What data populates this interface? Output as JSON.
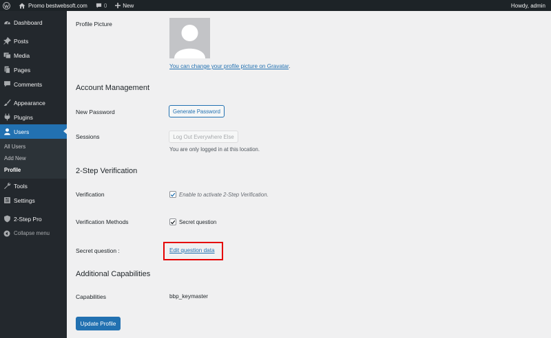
{
  "admin_bar": {
    "site_name": "Promo bestwebsoft.com",
    "comments_count": "0",
    "new_label": "New",
    "howdy": "Howdy, admin"
  },
  "sidebar": {
    "items": [
      {
        "label": "Dashboard",
        "icon": "dashboard-icon"
      },
      {
        "label": "Posts",
        "icon": "pin-icon"
      },
      {
        "label": "Media",
        "icon": "media-icon"
      },
      {
        "label": "Pages",
        "icon": "pages-icon"
      },
      {
        "label": "Comments",
        "icon": "comments-icon"
      },
      {
        "label": "Appearance",
        "icon": "paintbrush-icon"
      },
      {
        "label": "Plugins",
        "icon": "plugin-icon"
      },
      {
        "label": "Users",
        "icon": "user-icon"
      },
      {
        "label": "Tools",
        "icon": "wrench-icon"
      },
      {
        "label": "Settings",
        "icon": "settings-icon"
      },
      {
        "label": "2-Step Pro",
        "icon": "shield-icon"
      }
    ],
    "users_submenu": [
      "All Users",
      "Add New",
      "Profile"
    ],
    "collapse_label": "Collapse menu"
  },
  "profile": {
    "picture_label": "Profile Picture",
    "gravatar_link": "You can change your profile picture on Gravatar",
    "gravatar_suffix": ".",
    "account_title": "Account Management",
    "new_password_label": "New Password",
    "generate_password_button": "Generate Password",
    "sessions_label": "Sessions",
    "logout_everywhere_button": "Log Out Everywhere Else",
    "sessions_note": "You are only logged in at this location.",
    "two_step_title": "2-Step Verification",
    "verification_label": "Verification",
    "verification_checkbox_label": "Enable to activate 2-Step Verification.",
    "verification_checked": true,
    "methods_label": "Verification Methods",
    "secret_question_checkbox_label": "Secret question",
    "secret_question_checked": true,
    "secret_question_label": "Secret question :",
    "edit_question_link": "Edit question data",
    "capabilities_title": "Additional Capabilities",
    "capabilities_label": "Capabilities",
    "capabilities_value": "bbp_keymaster",
    "update_button": "Update Profile"
  },
  "colors": {
    "accent": "#2271b1",
    "admin_bar": "#1d2327",
    "sidebar": "#23282d",
    "highlight_box": "#e50000"
  }
}
